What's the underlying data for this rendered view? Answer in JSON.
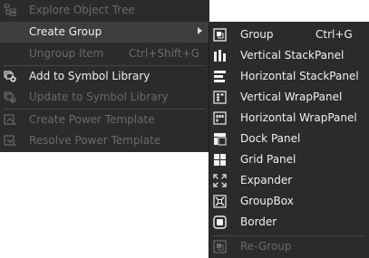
{
  "main_menu": {
    "items": [
      {
        "label": "Explore Object Tree",
        "shortcut": "",
        "enabled": false,
        "icon": "tree-icon"
      },
      {
        "label": "Create Group",
        "shortcut": "",
        "enabled": true,
        "highlighted": true,
        "has_submenu": true,
        "icon": ""
      },
      {
        "label": "Ungroup Item",
        "shortcut": "Ctrl+Shift+G",
        "enabled": false,
        "icon": ""
      },
      {
        "label": "Add to Symbol Library",
        "shortcut": "",
        "enabled": true,
        "icon": "symbol-add-icon"
      },
      {
        "label": "Update to Symbol Library",
        "shortcut": "",
        "enabled": false,
        "icon": "symbol-update-icon"
      },
      {
        "label": "Create Power Template",
        "shortcut": "",
        "enabled": false,
        "icon": "template-create-icon"
      },
      {
        "label": "Resolve Power Template",
        "shortcut": "",
        "enabled": false,
        "icon": "template-resolve-icon"
      }
    ]
  },
  "sub_menu": {
    "items": [
      {
        "label": "Group",
        "shortcut": "Ctrl+G",
        "enabled": true,
        "icon": "group-icon"
      },
      {
        "label": "Vertical StackPanel",
        "shortcut": "",
        "enabled": true,
        "icon": "vertical-stackpanel-icon"
      },
      {
        "label": "Horizontal StackPanel",
        "shortcut": "",
        "enabled": true,
        "icon": "horizontal-stackpanel-icon"
      },
      {
        "label": "Vertical WrapPanel",
        "shortcut": "",
        "enabled": true,
        "icon": "vertical-wrappanel-icon"
      },
      {
        "label": "Horizontal WrapPanel",
        "shortcut": "",
        "enabled": true,
        "icon": "horizontal-wrappanel-icon"
      },
      {
        "label": "Dock Panel",
        "shortcut": "",
        "enabled": true,
        "icon": "dock-panel-icon"
      },
      {
        "label": "Grid Panel",
        "shortcut": "",
        "enabled": true,
        "icon": "grid-panel-icon"
      },
      {
        "label": "Expander",
        "shortcut": "",
        "enabled": true,
        "icon": "expander-icon"
      },
      {
        "label": "GroupBox",
        "shortcut": "",
        "enabled": true,
        "icon": "groupbox-icon"
      },
      {
        "label": "Border",
        "shortcut": "",
        "enabled": true,
        "icon": "border-icon"
      },
      {
        "label": "Re-Group",
        "shortcut": "",
        "enabled": false,
        "icon": "regroup-icon"
      }
    ]
  },
  "colors": {
    "menu_bg": "#2b2b2b",
    "highlight_bg": "#3d3d3d",
    "text_enabled": "#f0f0f0",
    "text_disabled": "#6a6a6a"
  }
}
